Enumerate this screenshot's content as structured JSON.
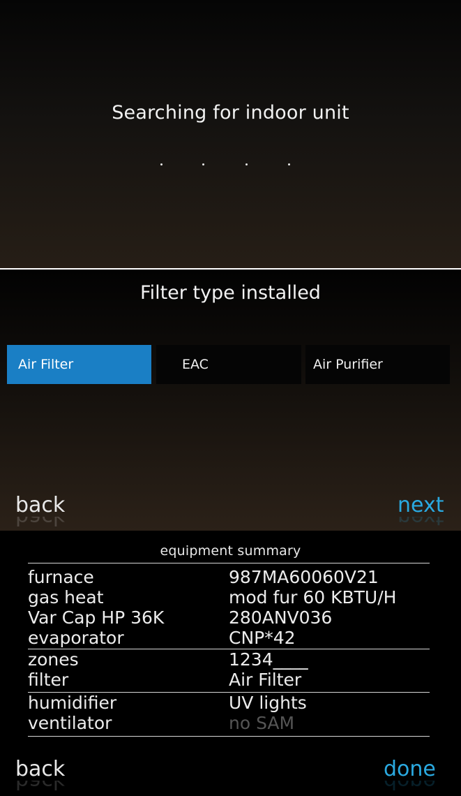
{
  "screen_searching": {
    "title": "Searching for indoor unit",
    "dots": 4
  },
  "screen_filter": {
    "title": "Filter type installed",
    "options": [
      {
        "label": "Air Filter",
        "selected": true
      },
      {
        "label": "EAC",
        "selected": false
      },
      {
        "label": "Air Purifier",
        "selected": false
      }
    ],
    "back_label": "back",
    "next_label": "next"
  },
  "screen_summary": {
    "heading": "equipment summary",
    "rows": [
      {
        "label": "furnace",
        "value": "987MA60060V21"
      },
      {
        "label": "gas heat",
        "value": "mod fur 60 KBTU/H"
      },
      {
        "label": "Var Cap HP 36K",
        "value": "280ANV036"
      },
      {
        "label": "evaporator",
        "value": "CNP*42"
      },
      {
        "label": "zones",
        "value": "1234____"
      },
      {
        "label": "filter",
        "value": "Air Filter"
      },
      {
        "label": "humidifier",
        "value": "UV lights"
      },
      {
        "label": "ventilator",
        "value": "no SAM"
      }
    ],
    "back_label": "back",
    "done_label": "done"
  },
  "colors": {
    "accent": "#2aa9e0",
    "selected_bg": "#1a7fc5",
    "dim_text": "#555555"
  }
}
